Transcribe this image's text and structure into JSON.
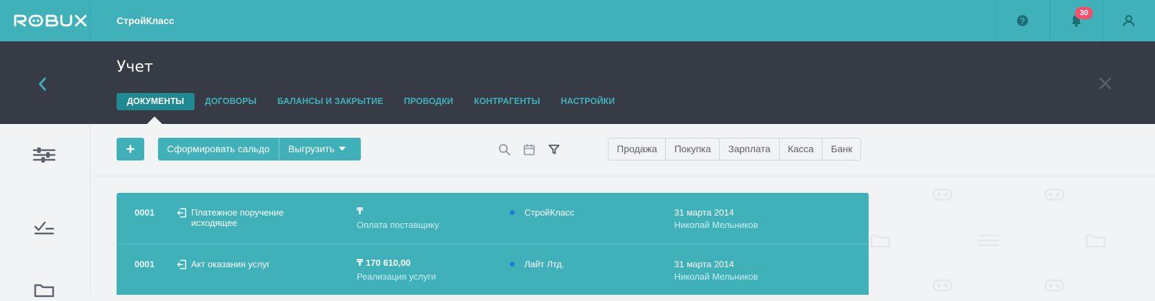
{
  "app": {
    "logo_text": "ROBUX",
    "company": "СтройКласс"
  },
  "topbar": {
    "notifications_count": "30"
  },
  "header": {
    "title": "Учет",
    "tabs": [
      {
        "label": "ДОКУМЕНТЫ",
        "active": true
      },
      {
        "label": "ДОГОВОРЫ",
        "active": false
      },
      {
        "label": "БАЛАНСЫ И ЗАКРЫТИЕ",
        "active": false
      },
      {
        "label": "ПРОВОДКИ",
        "active": false
      },
      {
        "label": "КОНТРАГЕНТЫ",
        "active": false
      },
      {
        "label": "НАСТРОЙКИ",
        "active": false
      }
    ]
  },
  "toolbar": {
    "add_label": "+",
    "balance_label": "Сформировать сальдо",
    "export_label": "Выгрузить",
    "filters": [
      "Продажа",
      "Покупка",
      "Зарплата",
      "Касса",
      "Банк"
    ]
  },
  "documents": [
    {
      "number": "0001",
      "name": "Платежное поручение исходящее",
      "currency": "₸",
      "amount": "",
      "purpose": "Оплата поставщику",
      "counterparty": "СтройКласс",
      "date": "31 марта 2014",
      "author": "Николай Мельников"
    },
    {
      "number": "0001",
      "name": "Акт оказания услуг",
      "currency": "₸",
      "amount": "170 610,00",
      "purpose": "Реализация услуги",
      "counterparty": "Лайт Лтд.",
      "date": "31 марта 2014",
      "author": "Николай Мельников"
    }
  ],
  "colors": {
    "brand": "#40b1b9",
    "header_dark": "#363b46",
    "active_tab": "#1f8a91",
    "badge": "#f0516c",
    "status_dot": "#1a7fd6"
  }
}
